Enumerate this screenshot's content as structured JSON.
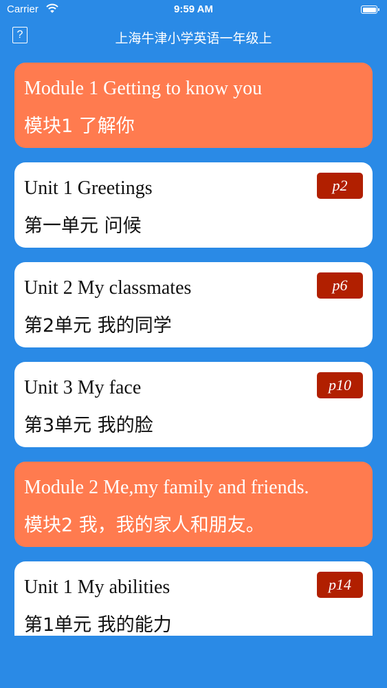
{
  "status_bar": {
    "carrier": "Carrier",
    "time": "9:59 AM",
    "battery_level": 1.0
  },
  "nav": {
    "help_icon": "question-mark-box-icon",
    "help_label": "?",
    "title": "上海牛津小学英语一年级上"
  },
  "colors": {
    "background": "#2a8ae6",
    "module_card": "#ff7b4f",
    "unit_card": "#ffffff",
    "page_badge": "#b11f00"
  },
  "items": [
    {
      "type": "module",
      "en": "Module 1 Getting to know you",
      "zh": "模块1 了解你"
    },
    {
      "type": "unit",
      "en": "Unit 1 Greetings",
      "zh": "第一单元 问候",
      "page": "p2"
    },
    {
      "type": "unit",
      "en": "Unit 2 My classmates",
      "zh": "第2单元 我的同学",
      "page": "p6"
    },
    {
      "type": "unit",
      "en": "Unit 3 My face",
      "zh": "第3单元 我的脸",
      "page": "p10"
    },
    {
      "type": "module",
      "en": "Module 2 Me,my family and friends.",
      "zh": "模块2 我，我的家人和朋友。"
    },
    {
      "type": "unit",
      "en": "Unit 1 My abilities",
      "zh": "第1单元 我的能力",
      "page": "p14"
    }
  ]
}
